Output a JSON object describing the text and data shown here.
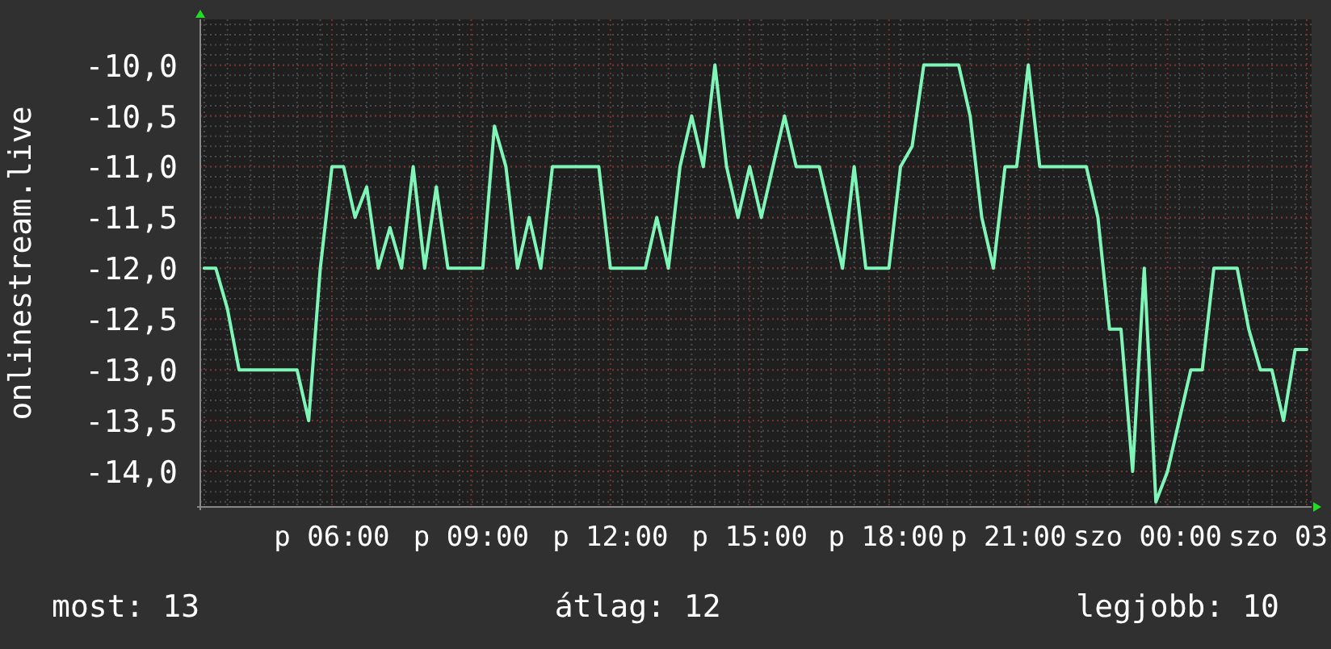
{
  "chart_data": {
    "type": "line",
    "ylabel": "onlinestream.live",
    "grid": true,
    "categories": [
      null,
      null,
      null,
      null,
      null,
      null,
      null,
      null,
      null,
      null,
      null,
      "p 06:00",
      null,
      null,
      null,
      null,
      null,
      null,
      null,
      null,
      null,
      null,
      null,
      "p 09:00",
      null,
      null,
      null,
      null,
      null,
      null,
      null,
      null,
      null,
      null,
      null,
      "p 12:00",
      null,
      null,
      null,
      null,
      null,
      null,
      null,
      null,
      null,
      null,
      null,
      "p 15:00",
      null,
      null,
      null,
      null,
      null,
      null,
      null,
      null,
      null,
      null,
      null,
      "p 18:00",
      null,
      null,
      null,
      null,
      null,
      null,
      null,
      null,
      null,
      null,
      null,
      "p 21:00",
      null,
      null,
      null,
      null,
      null,
      null,
      null,
      null,
      null,
      null,
      null,
      "szo 00:00",
      null,
      null,
      null,
      null,
      null,
      null,
      null,
      null,
      null,
      null,
      null,
      "szo 03"
    ],
    "series": [
      {
        "color": "#7ff5b8",
        "values": [
          -12.0,
          -12.0,
          -12.4,
          -13.0,
          -13.0,
          -13.0,
          -13.0,
          -13.0,
          -13.0,
          -13.5,
          -12.0,
          -11.0,
          -11.0,
          -11.5,
          -11.2,
          -12.0,
          -11.6,
          -12.0,
          -11.0,
          -12.0,
          -11.2,
          -12.0,
          -12.0,
          -12.0,
          -12.0,
          -10.6,
          -11.0,
          -12.0,
          -11.5,
          -12.0,
          -11.0,
          -11.0,
          -11.0,
          -11.0,
          -11.0,
          -12.0,
          -12.0,
          -12.0,
          -12.0,
          -11.5,
          -12.0,
          -11.0,
          -10.5,
          -11.0,
          -10.0,
          -11.0,
          -11.5,
          -11.0,
          -11.5,
          -11.0,
          -10.5,
          -11.0,
          -11.0,
          -11.0,
          -11.5,
          -12.0,
          -11.0,
          -12.0,
          -12.0,
          -12.0,
          -11.0,
          -10.8,
          -10.0,
          -10.0,
          -10.0,
          -10.0,
          -10.5,
          -11.5,
          -12.0,
          -11.0,
          -11.0,
          -10.0,
          -11.0,
          -11.0,
          -11.0,
          -11.0,
          -11.0,
          -11.5,
          -12.6,
          -12.6,
          -14.0,
          -12.0,
          -14.3,
          -14.0,
          -13.5,
          -13.0,
          -13.0,
          -12.0,
          -12.0,
          -12.0,
          -12.6,
          -13.0,
          -13.0,
          -13.5,
          -12.8,
          -12.8
        ]
      }
    ],
    "ylim": [
      -14.35,
      -9.55
    ],
    "yticks": [
      {
        "value": -10,
        "label": "-10,0"
      },
      {
        "value": -10.5,
        "label": "-10,5"
      },
      {
        "value": -11,
        "label": "-11,0"
      },
      {
        "value": -11.5,
        "label": "-11,5"
      },
      {
        "value": -12,
        "label": "-12,0"
      },
      {
        "value": -12.5,
        "label": "-12,5"
      },
      {
        "value": -13,
        "label": "-13,0"
      },
      {
        "value": -13.5,
        "label": "-13,5"
      },
      {
        "value": -14,
        "label": "-14,0"
      }
    ]
  },
  "stats": [
    "most: 13",
    "átlag: 12",
    "legjobb: 10"
  ]
}
